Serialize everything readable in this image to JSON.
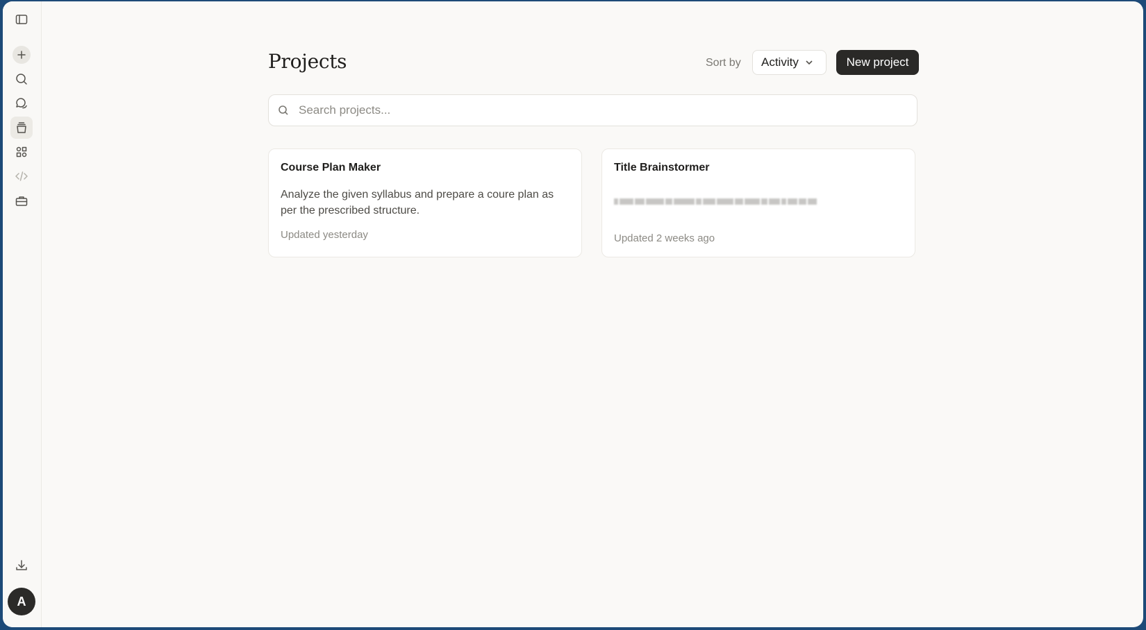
{
  "sidebar": {
    "items": [
      {
        "name": "sidebar-toggle-icon"
      },
      {
        "name": "new-chat-plus-icon"
      },
      {
        "name": "search-icon"
      },
      {
        "name": "chats-icon"
      },
      {
        "name": "projects-icon"
      },
      {
        "name": "artifacts-icon"
      },
      {
        "name": "code-icon"
      },
      {
        "name": "toolbox-icon"
      },
      {
        "name": "download-icon"
      }
    ],
    "avatar_letter": "A"
  },
  "header": {
    "title": "Projects",
    "sort_label": "Sort by",
    "sort_value": "Activity",
    "new_project_label": "New project"
  },
  "search": {
    "placeholder": "Search projects..."
  },
  "projects": [
    {
      "title": "Course Plan Maker",
      "description": "Analyze the given syllabus and prepare a coure plan as per the prescribed structure.",
      "updated": "Updated yesterday"
    },
    {
      "title": "Title Brainstormer",
      "description": "",
      "updated": "Updated 2 weeks ago"
    }
  ],
  "colors": {
    "background": "#faf9f7",
    "primary_button": "#2a2927",
    "desktop": "#1d4a78"
  }
}
